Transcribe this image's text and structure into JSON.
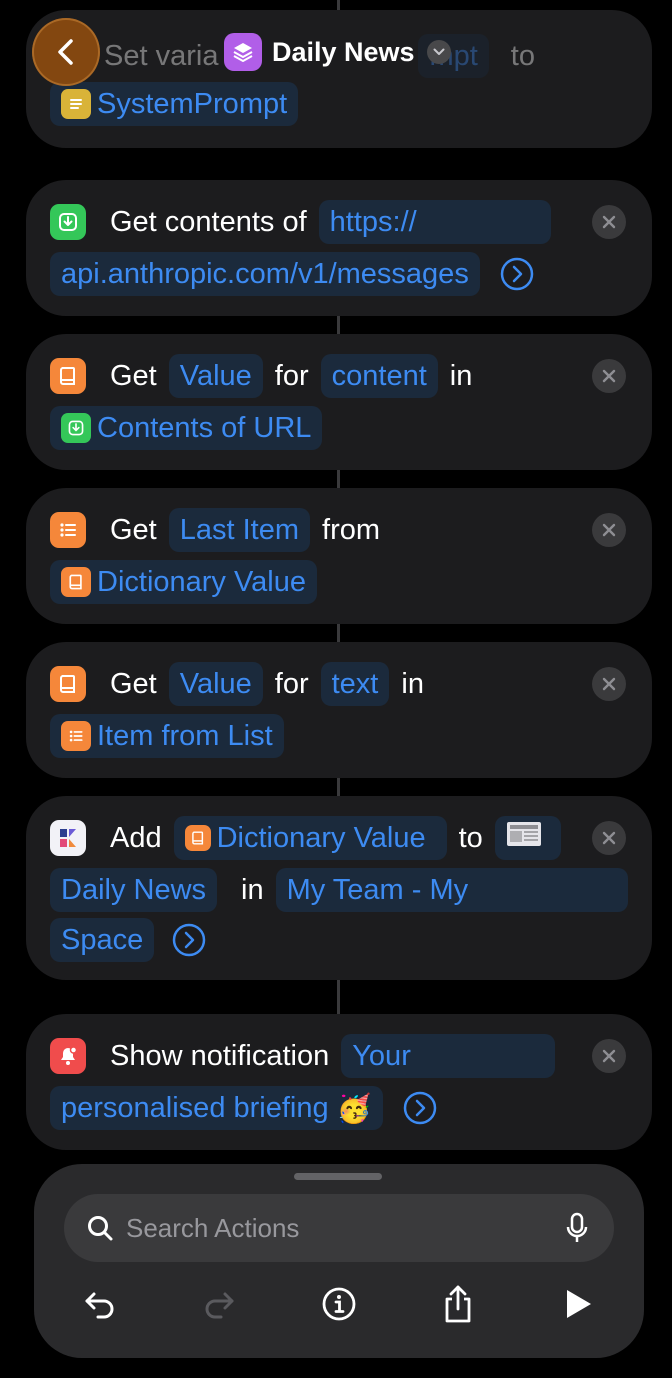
{
  "header": {
    "back_icon": "chevron-left-icon",
    "title": "Daily News",
    "title_icon": "stack-icon",
    "behind_text": {
      "set_variable": "Set varia",
      "prompt": "mpt",
      "to": "to"
    }
  },
  "actions": [
    {
      "id": "set-variable",
      "tokens": [
        {
          "text": "SystemPrompt",
          "icon": "text-icon"
        }
      ]
    },
    {
      "id": "get-contents",
      "verb": "Get contents of",
      "url_part1": "https://",
      "url_part2": "api.anthropic.com/v1/messages"
    },
    {
      "id": "get-value-content",
      "verb": "Get",
      "key_token": "Value",
      "for": "for",
      "field": "content",
      "in": "in",
      "source": "Contents of URL"
    },
    {
      "id": "get-item",
      "verb": "Get",
      "item": "Last Item",
      "from": "from",
      "source": "Dictionary Value"
    },
    {
      "id": "get-value-text",
      "verb": "Get",
      "key_token": "Value",
      "for": "for",
      "field": "text",
      "in": "in",
      "source": "Item from List"
    },
    {
      "id": "add-to-db",
      "verb": "Add",
      "value_token": "Dictionary Value",
      "to": "to",
      "db": "Daily News",
      "in": "in",
      "team_part1": "My Team - My",
      "team_part2": "Space"
    },
    {
      "id": "show-notification",
      "verb": "Show notification",
      "text_part1": "Your",
      "text_part2": "personalised briefing",
      "emoji": "🥳"
    }
  ],
  "search": {
    "placeholder": "Search Actions"
  },
  "toolbar": [
    "undo-icon",
    "redo-icon",
    "info-icon",
    "share-icon",
    "play-icon"
  ]
}
